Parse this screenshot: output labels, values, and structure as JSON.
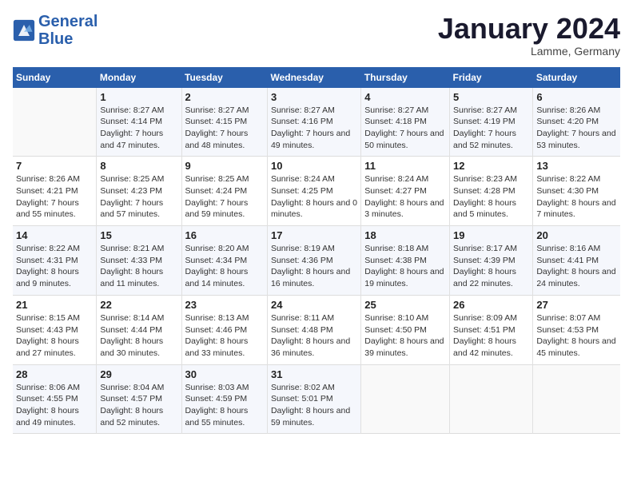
{
  "header": {
    "logo_line1": "General",
    "logo_line2": "Blue",
    "month": "January 2024",
    "location": "Lamme, Germany"
  },
  "days_of_week": [
    "Sunday",
    "Monday",
    "Tuesday",
    "Wednesday",
    "Thursday",
    "Friday",
    "Saturday"
  ],
  "weeks": [
    [
      {
        "day": "",
        "sunrise": "",
        "sunset": "",
        "daylight": ""
      },
      {
        "day": "1",
        "sunrise": "Sunrise: 8:27 AM",
        "sunset": "Sunset: 4:14 PM",
        "daylight": "Daylight: 7 hours and 47 minutes."
      },
      {
        "day": "2",
        "sunrise": "Sunrise: 8:27 AM",
        "sunset": "Sunset: 4:15 PM",
        "daylight": "Daylight: 7 hours and 48 minutes."
      },
      {
        "day": "3",
        "sunrise": "Sunrise: 8:27 AM",
        "sunset": "Sunset: 4:16 PM",
        "daylight": "Daylight: 7 hours and 49 minutes."
      },
      {
        "day": "4",
        "sunrise": "Sunrise: 8:27 AM",
        "sunset": "Sunset: 4:18 PM",
        "daylight": "Daylight: 7 hours and 50 minutes."
      },
      {
        "day": "5",
        "sunrise": "Sunrise: 8:27 AM",
        "sunset": "Sunset: 4:19 PM",
        "daylight": "Daylight: 7 hours and 52 minutes."
      },
      {
        "day": "6",
        "sunrise": "Sunrise: 8:26 AM",
        "sunset": "Sunset: 4:20 PM",
        "daylight": "Daylight: 7 hours and 53 minutes."
      }
    ],
    [
      {
        "day": "7",
        "sunrise": "Sunrise: 8:26 AM",
        "sunset": "Sunset: 4:21 PM",
        "daylight": "Daylight: 7 hours and 55 minutes."
      },
      {
        "day": "8",
        "sunrise": "Sunrise: 8:25 AM",
        "sunset": "Sunset: 4:23 PM",
        "daylight": "Daylight: 7 hours and 57 minutes."
      },
      {
        "day": "9",
        "sunrise": "Sunrise: 8:25 AM",
        "sunset": "Sunset: 4:24 PM",
        "daylight": "Daylight: 7 hours and 59 minutes."
      },
      {
        "day": "10",
        "sunrise": "Sunrise: 8:24 AM",
        "sunset": "Sunset: 4:25 PM",
        "daylight": "Daylight: 8 hours and 0 minutes."
      },
      {
        "day": "11",
        "sunrise": "Sunrise: 8:24 AM",
        "sunset": "Sunset: 4:27 PM",
        "daylight": "Daylight: 8 hours and 3 minutes."
      },
      {
        "day": "12",
        "sunrise": "Sunrise: 8:23 AM",
        "sunset": "Sunset: 4:28 PM",
        "daylight": "Daylight: 8 hours and 5 minutes."
      },
      {
        "day": "13",
        "sunrise": "Sunrise: 8:22 AM",
        "sunset": "Sunset: 4:30 PM",
        "daylight": "Daylight: 8 hours and 7 minutes."
      }
    ],
    [
      {
        "day": "14",
        "sunrise": "Sunrise: 8:22 AM",
        "sunset": "Sunset: 4:31 PM",
        "daylight": "Daylight: 8 hours and 9 minutes."
      },
      {
        "day": "15",
        "sunrise": "Sunrise: 8:21 AM",
        "sunset": "Sunset: 4:33 PM",
        "daylight": "Daylight: 8 hours and 11 minutes."
      },
      {
        "day": "16",
        "sunrise": "Sunrise: 8:20 AM",
        "sunset": "Sunset: 4:34 PM",
        "daylight": "Daylight: 8 hours and 14 minutes."
      },
      {
        "day": "17",
        "sunrise": "Sunrise: 8:19 AM",
        "sunset": "Sunset: 4:36 PM",
        "daylight": "Daylight: 8 hours and 16 minutes."
      },
      {
        "day": "18",
        "sunrise": "Sunrise: 8:18 AM",
        "sunset": "Sunset: 4:38 PM",
        "daylight": "Daylight: 8 hours and 19 minutes."
      },
      {
        "day": "19",
        "sunrise": "Sunrise: 8:17 AM",
        "sunset": "Sunset: 4:39 PM",
        "daylight": "Daylight: 8 hours and 22 minutes."
      },
      {
        "day": "20",
        "sunrise": "Sunrise: 8:16 AM",
        "sunset": "Sunset: 4:41 PM",
        "daylight": "Daylight: 8 hours and 24 minutes."
      }
    ],
    [
      {
        "day": "21",
        "sunrise": "Sunrise: 8:15 AM",
        "sunset": "Sunset: 4:43 PM",
        "daylight": "Daylight: 8 hours and 27 minutes."
      },
      {
        "day": "22",
        "sunrise": "Sunrise: 8:14 AM",
        "sunset": "Sunset: 4:44 PM",
        "daylight": "Daylight: 8 hours and 30 minutes."
      },
      {
        "day": "23",
        "sunrise": "Sunrise: 8:13 AM",
        "sunset": "Sunset: 4:46 PM",
        "daylight": "Daylight: 8 hours and 33 minutes."
      },
      {
        "day": "24",
        "sunrise": "Sunrise: 8:11 AM",
        "sunset": "Sunset: 4:48 PM",
        "daylight": "Daylight: 8 hours and 36 minutes."
      },
      {
        "day": "25",
        "sunrise": "Sunrise: 8:10 AM",
        "sunset": "Sunset: 4:50 PM",
        "daylight": "Daylight: 8 hours and 39 minutes."
      },
      {
        "day": "26",
        "sunrise": "Sunrise: 8:09 AM",
        "sunset": "Sunset: 4:51 PM",
        "daylight": "Daylight: 8 hours and 42 minutes."
      },
      {
        "day": "27",
        "sunrise": "Sunrise: 8:07 AM",
        "sunset": "Sunset: 4:53 PM",
        "daylight": "Daylight: 8 hours and 45 minutes."
      }
    ],
    [
      {
        "day": "28",
        "sunrise": "Sunrise: 8:06 AM",
        "sunset": "Sunset: 4:55 PM",
        "daylight": "Daylight: 8 hours and 49 minutes."
      },
      {
        "day": "29",
        "sunrise": "Sunrise: 8:04 AM",
        "sunset": "Sunset: 4:57 PM",
        "daylight": "Daylight: 8 hours and 52 minutes."
      },
      {
        "day": "30",
        "sunrise": "Sunrise: 8:03 AM",
        "sunset": "Sunset: 4:59 PM",
        "daylight": "Daylight: 8 hours and 55 minutes."
      },
      {
        "day": "31",
        "sunrise": "Sunrise: 8:02 AM",
        "sunset": "Sunset: 5:01 PM",
        "daylight": "Daylight: 8 hours and 59 minutes."
      },
      {
        "day": "",
        "sunrise": "",
        "sunset": "",
        "daylight": ""
      },
      {
        "day": "",
        "sunrise": "",
        "sunset": "",
        "daylight": ""
      },
      {
        "day": "",
        "sunrise": "",
        "sunset": "",
        "daylight": ""
      }
    ]
  ]
}
